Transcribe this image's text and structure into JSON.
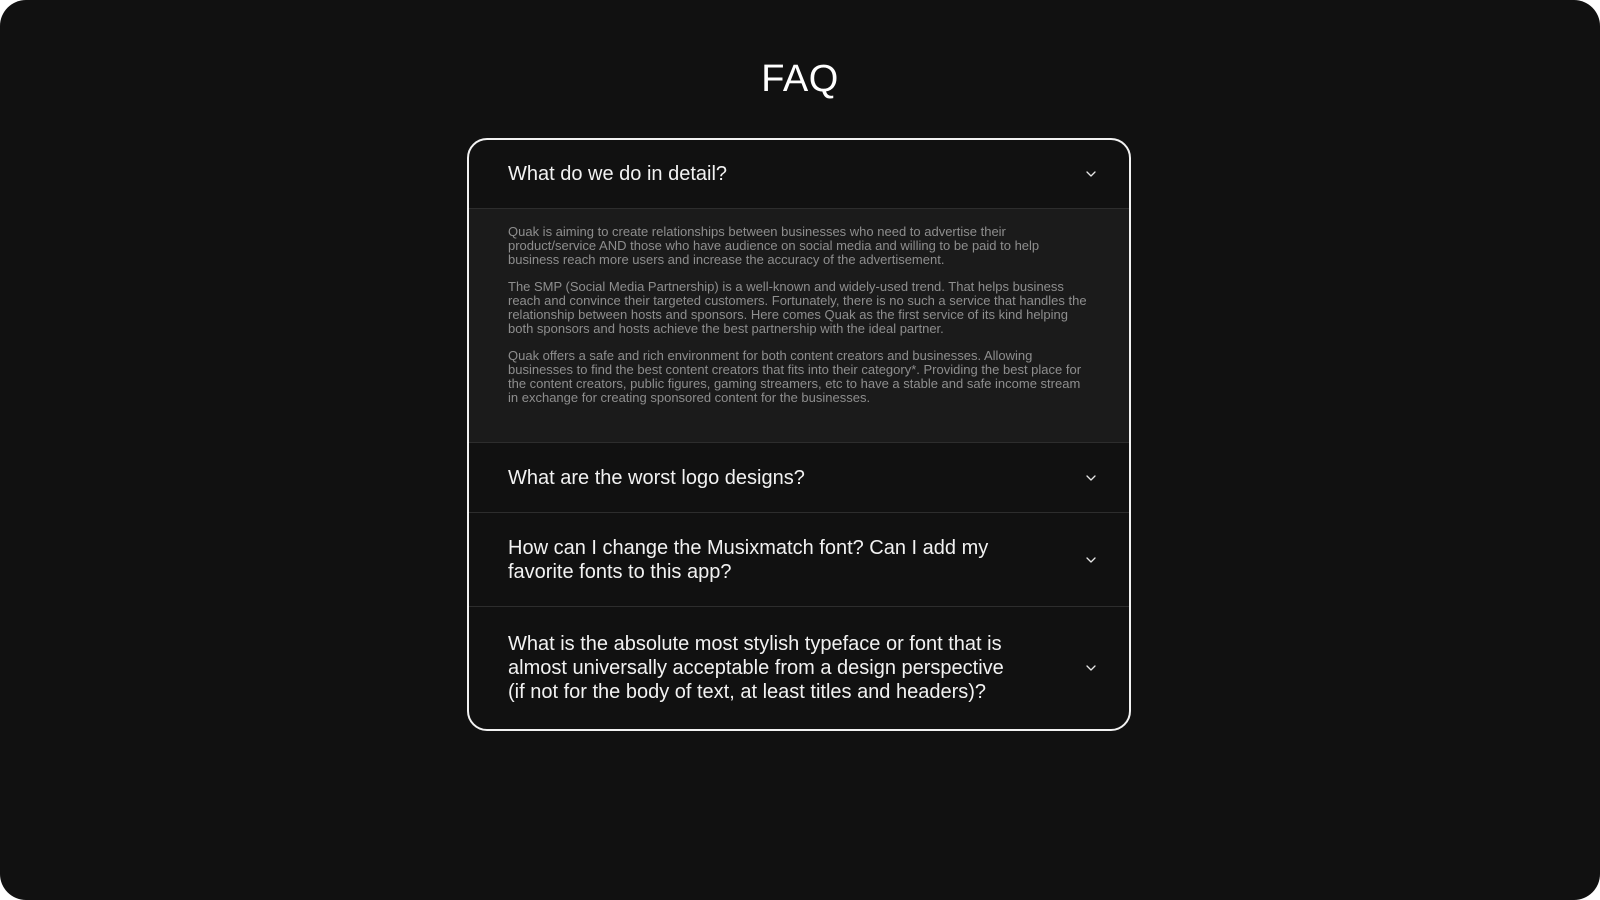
{
  "page": {
    "title": "FAQ"
  },
  "colors": {
    "background": "#111111",
    "card_border": "#f2f2f2",
    "question_text": "#f2f2f2",
    "answer_text": "#8e8e8e",
    "answer_background": "#1b1b1b"
  },
  "faq": {
    "items": [
      {
        "question": "What do we do in detail?",
        "expanded": true,
        "icon": "chevron-down-icon",
        "answer": [
          "Quak is aiming to create relationships between businesses who need to advertise their product/service AND those who have audience on social media and willing to be paid to help business reach more users and increase the accuracy of the advertisement.",
          "The SMP (Social Media Partnership) is a well-known and widely-used trend. That helps business reach and convince their targeted customers. Fortunately, there is no such a service that handles the relationship between hosts and sponsors. Here comes Quak as the first service of its kind helping both sponsors and hosts achieve the best partnership with the ideal partner.",
          "Quak offers a safe and rich environment for both content creators and businesses. Allowing businesses to find the best content creators that fits into their category*. Providing the best place for the content creators, public figures, gaming streamers, etc to have a stable and safe income stream in exchange for creating sponsored content for the businesses."
        ]
      },
      {
        "question": "What are the worst logo designs?",
        "expanded": false,
        "icon": "chevron-down-icon"
      },
      {
        "question": "How can I change the Musixmatch font? Can I add my favorite fonts to this app?",
        "expanded": false,
        "icon": "chevron-down-icon"
      },
      {
        "question": "What is the absolute most stylish typeface or font that is almost universally acceptable from a design perspective (if not for the body of text, at least titles and headers)?",
        "expanded": false,
        "icon": "chevron-down-icon"
      }
    ]
  }
}
